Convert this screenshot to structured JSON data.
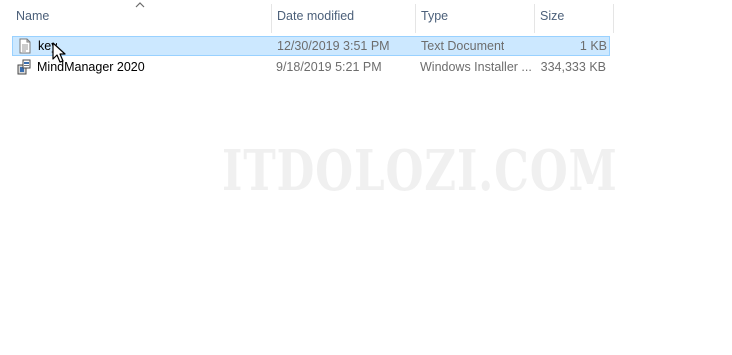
{
  "columns": {
    "name": "Name",
    "date_modified": "Date modified",
    "type": "Type",
    "size": "Size"
  },
  "sort": {
    "column": "name",
    "direction": "ascending",
    "icon": "chevron-up-icon"
  },
  "files": [
    {
      "name": "key",
      "date_modified": "12/30/2019 3:51 PM",
      "type": "Text Document",
      "size": "1 KB",
      "icon": "text-file-icon",
      "selected": true
    },
    {
      "name": "MindManager 2020",
      "date_modified": "9/18/2019 5:21 PM",
      "type": "Windows Installer ...",
      "size": "334,333 KB",
      "icon": "installer-package-icon",
      "selected": false
    }
  ],
  "watermark": "ITDOLOZI.COM",
  "colors": {
    "selection_bg": "#cce8ff",
    "selection_border": "#99d1ff",
    "header_text": "#4c607a",
    "secondary_text": "#6d6d6d"
  }
}
